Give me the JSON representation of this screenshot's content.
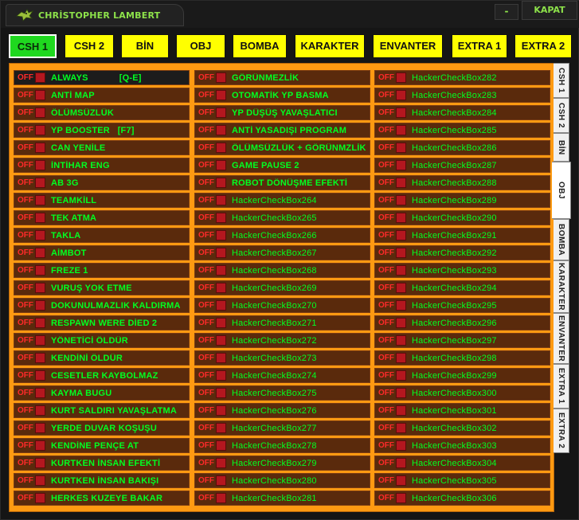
{
  "window": {
    "title": "CHRİSTOPHER LAMBERT",
    "minimize_label": "-",
    "close_label": "KAPAT"
  },
  "top_tabs": [
    "CSH 1",
    "CSH 2",
    "BİN",
    "OBJ",
    "BOMBA",
    "KARAKTER",
    "ENVANTER",
    "EXTRA 1",
    "EXTRA 2"
  ],
  "active_top_tab": "CSH 1",
  "side_tabs": [
    "CSH 1",
    "CSH 2",
    "BİN",
    "OBJ",
    "BOMBA",
    "KARAKTER",
    "ENVANTER",
    "EXTRA 1",
    "EXTRA 2"
  ],
  "active_side_tab": "OBJ",
  "state_label": "OFF",
  "columns": [
    [
      "ALWAYS            [Q-E]",
      "ANTİ MAP",
      "ÖLÜMSÜZLÜK",
      "YP BOOSTER   [F7]",
      "CAN YENİLE",
      "İNTİHAR ENG",
      "AB 3G",
      "TEAMKİLL",
      "TEK ATMA",
      "TAKLA",
      "AİMBOT",
      "FREZE 1",
      "VURUŞ YOK ETME",
      "DOKUNULMAZLIK KALDIRMA",
      "RESPAWN WERE DİED 2",
      "YÖNETİCİ ÖLDÜR",
      "KENDİNİ ÖLDÜR",
      "CESETLER KAYBOLMAZ",
      "KAYMA BUGU",
      "KURT SALDIRI YAVAŞLATMA",
      "YERDE DUVAR KOŞUŞU",
      "KENDİNE PENÇE AT",
      "KURTKEN İNSAN EFEKTİ",
      "KURTKEN İNSAN BAKIŞI",
      "HERKES KUZEYE BAKAR"
    ],
    [
      "GÖRÜNMEZLİK",
      "OTOMATİK YP BASMA",
      "YP DÜŞÜŞ YAVAŞLATICI",
      "ANTİ YASADIŞI PROGRAM",
      "ÖLÜMSÜZLÜK + GÖRÜNMZLİK",
      "GAME PAUSE 2",
      "ROBOT DÖNÜŞME EFEKTİ",
      "HackerCheckBox264",
      "HackerCheckBox265",
      "HackerCheckBox266",
      "HackerCheckBox267",
      "HackerCheckBox268",
      "HackerCheckBox269",
      "HackerCheckBox270",
      "HackerCheckBox271",
      "HackerCheckBox272",
      "HackerCheckBox273",
      "HackerCheckBox274",
      "HackerCheckBox275",
      "HackerCheckBox276",
      "HackerCheckBox277",
      "HackerCheckBox278",
      "HackerCheckBox279",
      "HackerCheckBox280",
      "HackerCheckBox281"
    ],
    [
      "HackerCheckBox282",
      "HackerCheckBox283",
      "HackerCheckBox284",
      "HackerCheckBox285",
      "HackerCheckBox286",
      "HackerCheckBox287",
      "HackerCheckBox288",
      "HackerCheckBox289",
      "HackerCheckBox290",
      "HackerCheckBox291",
      "HackerCheckBox292",
      "HackerCheckBox293",
      "HackerCheckBox294",
      "HackerCheckBox295",
      "HackerCheckBox296",
      "HackerCheckBox297",
      "HackerCheckBox298",
      "HackerCheckBox299",
      "HackerCheckBox300",
      "HackerCheckBox301",
      "HackerCheckBox302",
      "HackerCheckBox303",
      "HackerCheckBox304",
      "HackerCheckBox305",
      "HackerCheckBox306"
    ]
  ],
  "colors": {
    "panel": "#ff9a12",
    "cell": "#5a2a0c",
    "label": "#00ff22",
    "off": "#ff2a2a",
    "tab": "#ffff00",
    "tab_active": "#1fd81f"
  }
}
